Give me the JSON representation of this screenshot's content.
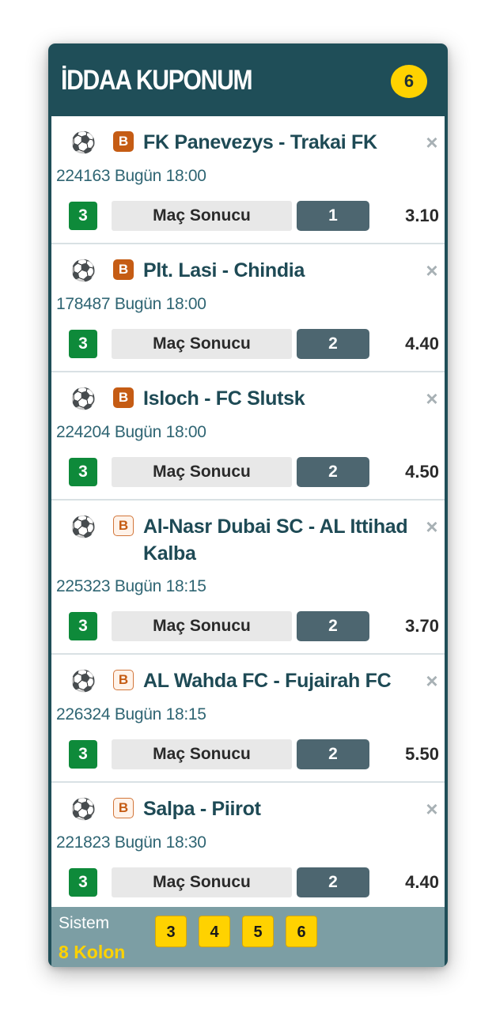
{
  "coupon": {
    "title": "İDDAA KUPONUM",
    "match_count": "6"
  },
  "matches": [
    {
      "teams": "FK Panevezys - Trakai FK",
      "badge": "B",
      "code": "224163",
      "day": "Bugün",
      "time": "18:00",
      "mbs": "3",
      "bet_type": "Maç Sonucu",
      "selection": "1",
      "odds": "3.10"
    },
    {
      "teams": "Plt. Lasi - Chindia",
      "badge": "B",
      "code": "178487",
      "day": "Bugün",
      "time": "18:00",
      "mbs": "3",
      "bet_type": "Maç Sonucu",
      "selection": "2",
      "odds": "4.40"
    },
    {
      "teams": "Isloch - FC Slutsk",
      "badge": "B",
      "code": "224204",
      "day": "Bugün",
      "time": "18:00",
      "mbs": "3",
      "bet_type": "Maç Sonucu",
      "selection": "2",
      "odds": "4.50"
    },
    {
      "teams": "Al-Nasr Dubai SC - AL Ittihad Kalba",
      "badge": "B",
      "code": "225323",
      "day": "Bugün",
      "time": "18:15",
      "mbs": "3",
      "bet_type": "Maç Sonucu",
      "selection": "2",
      "odds": "3.70"
    },
    {
      "teams": "AL Wahda FC - Fujairah FC",
      "badge": "B",
      "code": "226324",
      "day": "Bugün",
      "time": "18:15",
      "mbs": "3",
      "bet_type": "Maç Sonucu",
      "selection": "2",
      "odds": "5.50"
    },
    {
      "teams": "Salpa - Piirot",
      "badge": "B",
      "code": "221823",
      "day": "Bugün",
      "time": "18:30",
      "mbs": "3",
      "bet_type": "Maç Sonucu",
      "selection": "2",
      "odds": "4.40"
    }
  ],
  "footer": {
    "system_label": "Sistem",
    "kolon_count": "8",
    "kolon_label": "Kolon",
    "system_options": [
      "3",
      "4",
      "5",
      "6"
    ]
  },
  "colors": {
    "header_bg": "#1f4e58",
    "count_badge": "#ffd200",
    "mbs_green": "#0e8a3a",
    "selection_bg": "#4d6670",
    "badge_orange": "#c55c14",
    "footer_bg": "#7c9ea4",
    "kolon_yellow": "#ffd200"
  },
  "icons": {
    "sport": "soccer-ball-icon",
    "remove": "close-icon"
  }
}
